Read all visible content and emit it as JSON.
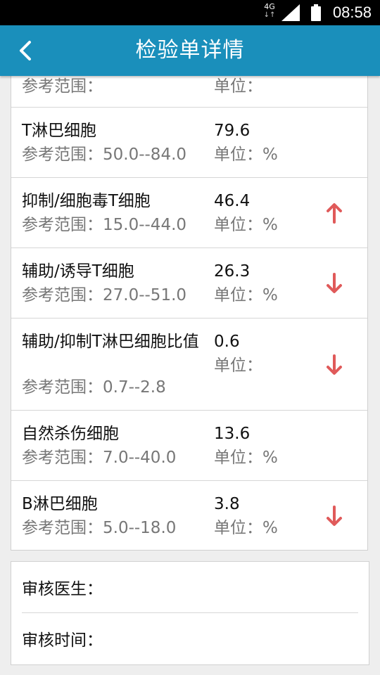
{
  "status_bar": {
    "network": "4G",
    "network_arrows": "↓↑",
    "time": "08:58"
  },
  "app_bar": {
    "title": "检验单详情",
    "back_icon": "chevron-left-icon"
  },
  "results": [
    {
      "name": "",
      "value": "",
      "ref_label": "参考范围：",
      "ref_range": "",
      "unit_label": "单位：",
      "unit": "",
      "flag": ""
    },
    {
      "name": "T淋巴细胞",
      "value": "79.6",
      "ref_label": "参考范围：",
      "ref_range": "50.0--84.0",
      "unit_label": "单位：",
      "unit": "%",
      "flag": ""
    },
    {
      "name": "抑制/细胞毒T细胞",
      "value": "46.4",
      "ref_label": "参考范围：",
      "ref_range": "15.0--44.0",
      "unit_label": "单位：",
      "unit": "%",
      "flag": "high"
    },
    {
      "name": "辅助/诱导T细胞",
      "value": "26.3",
      "ref_label": "参考范围：",
      "ref_range": "27.0--51.0",
      "unit_label": "单位：",
      "unit": "%",
      "flag": "low"
    },
    {
      "name": "辅助/抑制T淋巴细胞比值",
      "value": "0.6",
      "ref_label": "参考范围：",
      "ref_range": "0.7--2.8",
      "unit_label": "单位：",
      "unit": "",
      "flag": "low"
    },
    {
      "name": "自然杀伤细胞",
      "value": "13.6",
      "ref_label": "参考范围：",
      "ref_range": "7.0--40.0",
      "unit_label": "单位：",
      "unit": "%",
      "flag": ""
    },
    {
      "name": "B淋巴细胞",
      "value": "3.8",
      "ref_label": "参考范围：",
      "ref_range": "5.0--18.0",
      "unit_label": "单位：",
      "unit": "%",
      "flag": "low"
    }
  ],
  "audit": {
    "reviewer_label": "审核医生：",
    "reviewer": "",
    "review_time_label": "审核时间：",
    "review_time": ""
  },
  "colors": {
    "app_bar": "#1a8fbb",
    "flag_arrow": "#e05a5a",
    "status_bar": "#000000"
  }
}
